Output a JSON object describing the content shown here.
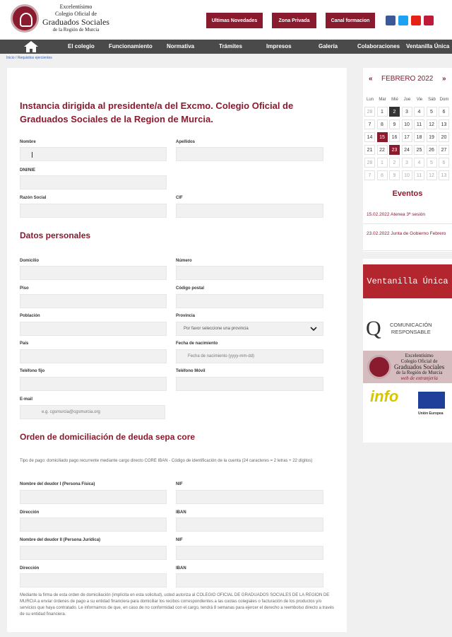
{
  "header": {
    "logo": {
      "line1": "Excelentísimo",
      "line2": "Colegio Oficial de",
      "line3": "Graduados Sociales",
      "line4": "de la Región de Murcia"
    },
    "buttons": [
      "Ultimas Novedades",
      "Zona Privada",
      "Canal formacion"
    ],
    "social_icons": [
      "facebook-icon",
      "twitter-icon",
      "youtube-icon",
      "mail-icon"
    ]
  },
  "nav": {
    "items": [
      "El colegio",
      "Funcionamiento",
      "Normativa",
      "Trámites",
      "Impresos",
      "Galería",
      "Colaboraciones",
      "Ventanilla Única"
    ]
  },
  "breadcrumb": "Inicio / Requisitos ejercientes",
  "form": {
    "title": "Instancia dirigida al presidente/a del Excmo. Colegio Oficial de Graduados Sociales de la Region de Murcia.",
    "labels": {
      "nombre": "Nombre",
      "apellidos": "Apellidos",
      "dni": "DNI/NIE",
      "razon": "Razón Social",
      "cif": "CIF",
      "domicilio": "Domicilio",
      "numero": "Número",
      "piso": "Piso",
      "cp": "Código postal",
      "poblacion": "Población",
      "provincia": "Provincia",
      "pais": "País",
      "fecha": "Fecha de nacimiento",
      "tel_fijo": "Teléfono fijo",
      "tel_movil": "Teléfono Móvil",
      "email": "E-mail",
      "deudor1": "Nombre del deudor I (Persona Física)",
      "nif1": "NIF",
      "dir1": "Dirección",
      "iban1": "IBAN",
      "deudor2": "Nombre del deudor II (Persona Jurídica)",
      "nif2": "NIF",
      "dir2": "Dirección",
      "iban2": "IBAN"
    },
    "placeholders": {
      "provincia": "Por favor seleccione una provincia",
      "fecha": "Fecha de nacimiento (yyyy-mm-dd)",
      "email": "e.g. cgsmurcia@cgsmurcia.org"
    },
    "section_personal": "Datos personales",
    "section_sepa": "Orden de domiciliación de deuda sepa core",
    "sepa_note": "Tipo de pago: domiciliado pago recurrente mediante cargo directo CORE IBAN - Código de identificación de la cuenta (24 caracteres = 2 letras + 22 dígitos)",
    "legal": "Mediante la firma de esta orden de domiciliación (implícita en esta solicitud), usted autoriza al COLEGIO OFICIAL DE GRADUADOS SOCIALES DE LA REGION DE MURCIA a enviar órdenes de pago a su entidad financiera para domiciliar los recibos correspondientes a las cuotas colegiales o facturación de los productos y/o servicios que haya contratado. Le informamos de que, en caso de no conformidad con el cargo, tendrá 8 semanas para ejercer el derecho a reembolso directo a través de su entidad financiera."
  },
  "calendar": {
    "month": "FEBRERO 2022",
    "prev": "«",
    "next": "»",
    "days_of_week": [
      "Lun",
      "Mar",
      "Mié",
      "Jue",
      "Vie",
      "Sáb",
      "Dom"
    ],
    "weeks": [
      [
        "28",
        "1",
        "2",
        "3",
        "4",
        "5",
        "6"
      ],
      [
        "7",
        "8",
        "9",
        "10",
        "11",
        "12",
        "13"
      ],
      [
        "14",
        "15",
        "16",
        "17",
        "18",
        "19",
        "20"
      ],
      [
        "21",
        "22",
        "23",
        "24",
        "25",
        "26",
        "27"
      ],
      [
        "28",
        "1",
        "2",
        "3",
        "4",
        "5",
        "6"
      ],
      [
        "7",
        "8",
        "9",
        "10",
        "11",
        "12",
        "13"
      ]
    ]
  },
  "events": {
    "title": "Eventos",
    "items": [
      "15.02.2022 Atenea 3ª sesión",
      "23.02.2022 Junta de Gobierno Febrero"
    ]
  },
  "banners": {
    "ventanilla": "Ventanilla Única",
    "com_line1": "COMUNICACIÓN",
    "com_line2": "RESPONSABLE",
    "ext_line1": "Excelentísimo",
    "ext_line2": "Colegio Oficial de",
    "ext_line3": "Graduados Sociales",
    "ext_line4": "de la Región de Murcia",
    "ext_web": "web de extranjería",
    "info": "info",
    "eu_label": "Unión Europea"
  },
  "colors": {
    "brand": "#8a1a2e",
    "nav": "#4a4a4a"
  }
}
